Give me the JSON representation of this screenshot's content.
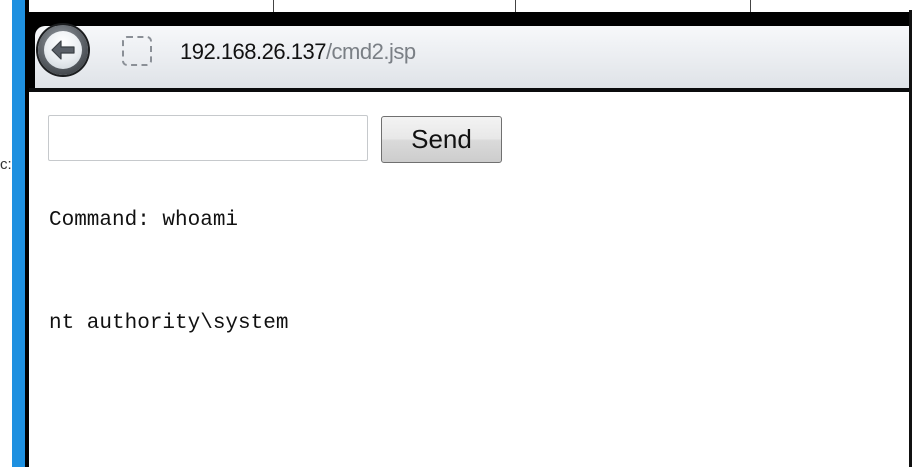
{
  "window": {
    "stray_text": "c:"
  },
  "browser": {
    "address": {
      "host": "192.168.26.137",
      "path": "/cmd2.jsp"
    },
    "icons": {
      "back": "back-arrow-icon",
      "page": "page-placeholder-icon"
    }
  },
  "page": {
    "input_value": "",
    "send_label": "Send",
    "command_label": "Command: whoami",
    "output": "nt authority\\system"
  },
  "colors": {
    "left_accent": "#1e90e0",
    "chrome_dark": "#000000"
  }
}
